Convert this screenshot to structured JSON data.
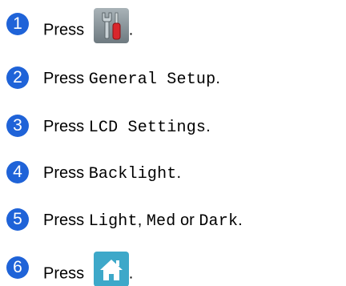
{
  "steps": [
    {
      "num": "1",
      "press": "Press",
      "suffix": ".",
      "icon": "tools-icon"
    },
    {
      "num": "2",
      "press": "Press",
      "item": "General Setup",
      "suffix": "."
    },
    {
      "num": "3",
      "press": "Press",
      "item": "LCD Settings",
      "suffix": "."
    },
    {
      "num": "4",
      "press": "Press",
      "item": "Backlight",
      "suffix": "."
    },
    {
      "num": "5",
      "press": "Press",
      "opt1": "Light",
      "comma": ",",
      "opt2": "Med",
      "or": "or",
      "opt3": "Dark",
      "suffix": "."
    },
    {
      "num": "6",
      "press": "Press",
      "suffix": ".",
      "icon": "home-icon"
    }
  ],
  "colors": {
    "step_badge": "#1f63d8",
    "home_icon_bg": "#3da8c9"
  }
}
